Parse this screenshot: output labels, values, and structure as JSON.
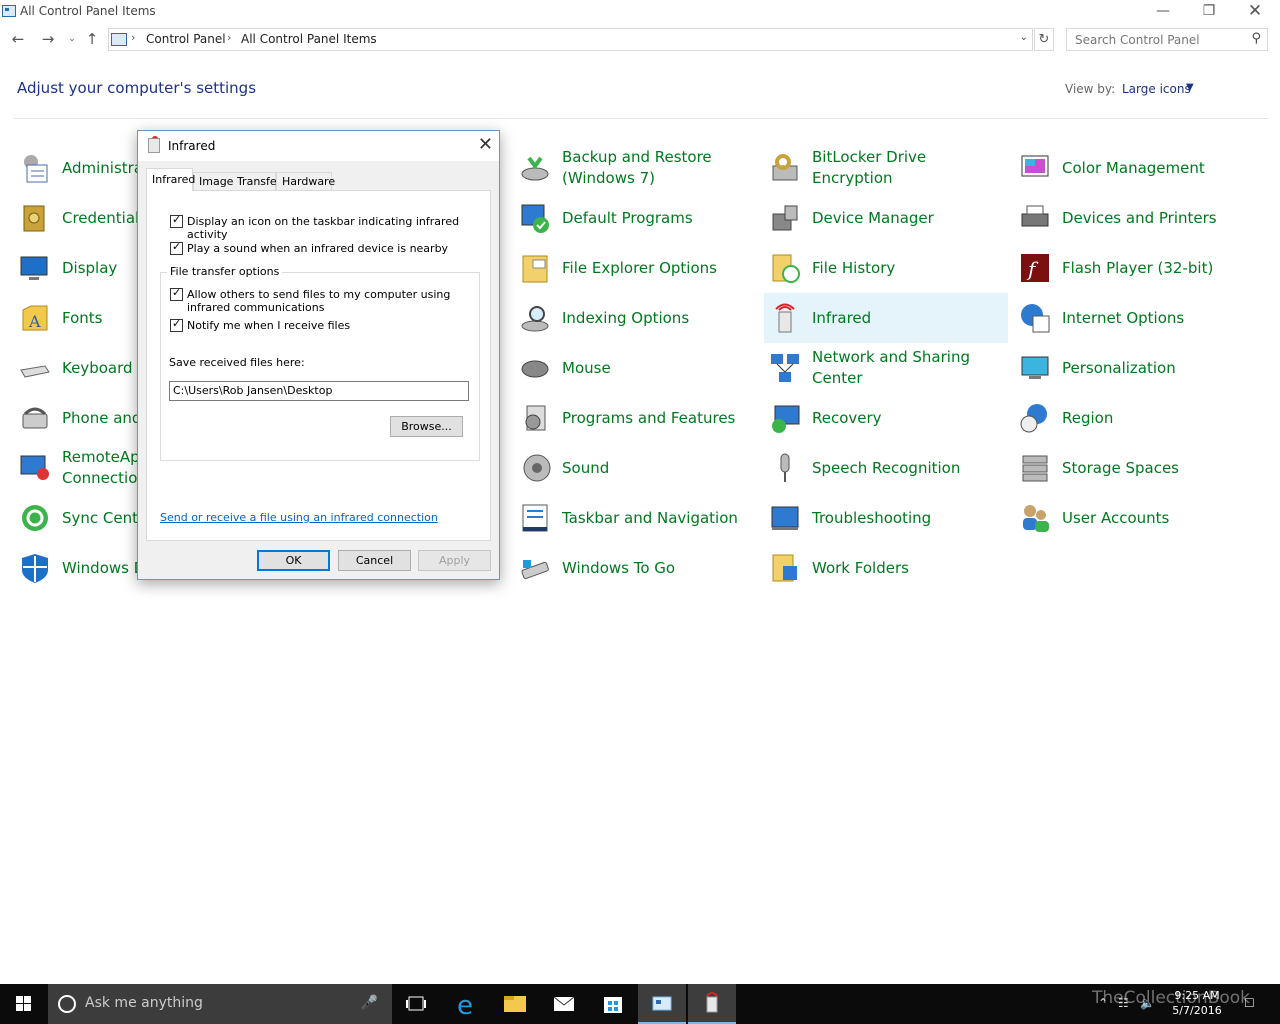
{
  "window": {
    "title": "All Control Panel Items",
    "minimize_icon": "minimize-icon",
    "restore_icon": "restore-icon",
    "close_icon": "close-icon"
  },
  "address": {
    "crumbs": [
      "Control Panel",
      "All Control Panel Items"
    ],
    "search_placeholder": "Search Control Panel"
  },
  "heading": "Adjust your computer's settings",
  "view_by": {
    "label": "View by:",
    "value": "Large icons"
  },
  "items": [
    {
      "label": "Administrative Tools",
      "icon": "admin-tools-icon"
    },
    {
      "label": "Credential Manager",
      "icon": "credential-manager-icon"
    },
    {
      "label": "Display",
      "icon": "display-icon"
    },
    {
      "label": "Fonts",
      "icon": "fonts-icon"
    },
    {
      "label": "Keyboard",
      "icon": "keyboard-icon"
    },
    {
      "label": "Phone and Modem",
      "icon": "phone-icon"
    },
    {
      "label": "RemoteApp and Desktop Connections",
      "icon": "remoteapp-icon"
    },
    {
      "label": "Sync Center",
      "icon": "sync-icon"
    },
    {
      "label": "Windows Defender",
      "icon": "defender-icon"
    },
    {
      "label": "Backup and Restore (Windows 7)",
      "icon": "backup-icon"
    },
    {
      "label": "Default Programs",
      "icon": "default-programs-icon"
    },
    {
      "label": "File Explorer Options",
      "icon": "folder-options-icon"
    },
    {
      "label": "Indexing Options",
      "icon": "indexing-icon"
    },
    {
      "label": "Mouse",
      "icon": "mouse-icon"
    },
    {
      "label": "Programs and Features",
      "icon": "programs-icon"
    },
    {
      "label": "Sound",
      "icon": "sound-icon"
    },
    {
      "label": "Taskbar and Navigation",
      "icon": "taskbar-icon"
    },
    {
      "label": "Windows To Go",
      "icon": "windows-to-go-icon"
    },
    {
      "label": "BitLocker Drive Encryption",
      "icon": "bitlocker-icon"
    },
    {
      "label": "Device Manager",
      "icon": "device-manager-icon"
    },
    {
      "label": "File History",
      "icon": "file-history-icon"
    },
    {
      "label": "Infrared",
      "icon": "infrared-icon"
    },
    {
      "label": "Network and Sharing Center",
      "icon": "network-icon"
    },
    {
      "label": "Recovery",
      "icon": "recovery-icon"
    },
    {
      "label": "Speech Recognition",
      "icon": "speech-icon"
    },
    {
      "label": "Troubleshooting",
      "icon": "troubleshooting-icon"
    },
    {
      "label": "Work Folders",
      "icon": "work-folders-icon"
    },
    {
      "label": "Color Management",
      "icon": "color-management-icon"
    },
    {
      "label": "Devices and Printers",
      "icon": "printers-icon"
    },
    {
      "label": "Flash Player (32-bit)",
      "icon": "flash-icon"
    },
    {
      "label": "Internet Options",
      "icon": "internet-options-icon"
    },
    {
      "label": "Personalization",
      "icon": "personalization-icon"
    },
    {
      "label": "Region",
      "icon": "region-icon"
    },
    {
      "label": "Storage Spaces",
      "icon": "storage-icon"
    },
    {
      "label": "User Accounts",
      "icon": "user-accounts-icon"
    }
  ],
  "dialog": {
    "title": "Infrared",
    "tabs": [
      "Infrared",
      "Image Transfer",
      "Hardware"
    ],
    "options": {
      "show_icon": "Display an icon on the taskbar indicating infrared activity",
      "play_sound": "Play a sound when an infrared device is nearby",
      "group_label": "File transfer options",
      "allow_send": "Allow others to send files to my computer using infrared communications",
      "notify": "Notify me when I receive files",
      "save_label": "Save received files here:",
      "save_path": "C:\\Users\\Rob Jansen\\Desktop",
      "browse": "Browse..."
    },
    "link": "Send or receive a file using an infrared connection",
    "ok": "OK",
    "cancel": "Cancel",
    "apply": "Apply"
  },
  "taskbar": {
    "search_text": "Ask me anything",
    "time": "9:25 AM",
    "date": "5/7/2016",
    "watermark": "TheCollectionBook"
  },
  "colors": {
    "link_green": "#00791f",
    "heading_blue": "#1e3287",
    "highlight": "#e5f3fb"
  }
}
